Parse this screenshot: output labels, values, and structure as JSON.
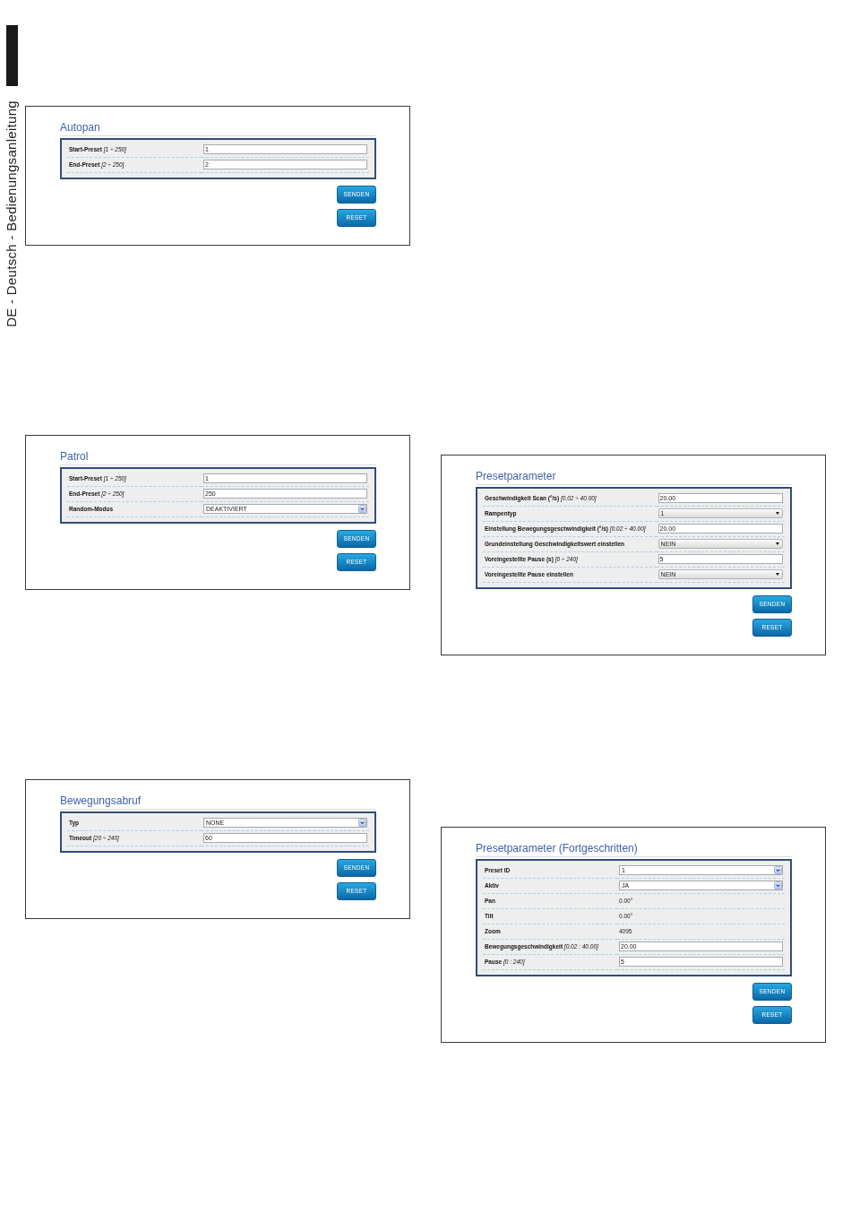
{
  "side_tab": {
    "label": "DE - Deutsch - Bedienungsanleitung"
  },
  "columns": [
    {
      "panels": [
        {
          "title": "Autopan",
          "fields": [
            {
              "kind": "input",
              "label": "Start-Preset",
              "range": "[1 ÷ 250]",
              "value": "1"
            },
            {
              "kind": "input",
              "label": "End-Preset",
              "range": "[2 ÷ 250]",
              "value": "2"
            }
          ],
          "buttons": [
            "SENDEN",
            "RESET"
          ]
        },
        {
          "title": "Patrol",
          "fields": [
            {
              "kind": "input",
              "label": "Start-Preset",
              "range": "[1 ÷ 250]",
              "value": "1"
            },
            {
              "kind": "input",
              "label": "End-Preset",
              "range": "[2 ÷ 250]",
              "value": "250"
            },
            {
              "kind": "select",
              "label": "Random-Modus",
              "value": "DEAKTIVIERT"
            }
          ],
          "buttons": [
            "SENDEN",
            "RESET"
          ]
        },
        {
          "title": "Bewegungsabruf",
          "fields": [
            {
              "kind": "select",
              "label": "Typ",
              "value": "NONE"
            },
            {
              "kind": "input",
              "label": "Timeout",
              "range": "[20 ÷ 240]",
              "value": "60"
            }
          ],
          "buttons": [
            "SENDEN",
            "RESET"
          ]
        }
      ]
    },
    {
      "panels": [
        {
          "title": "Presetparameter",
          "fields": [
            {
              "kind": "input",
              "label": "Geschwindigkeit Scan (°/s)",
              "range": "[0.02 ÷ 40.00]",
              "value": "20.00"
            },
            {
              "kind": "dropdown",
              "label": "Rampentyp",
              "value": "1"
            },
            {
              "kind": "input",
              "label": "Einstellung Bewegungsgeschwindigkeit (°/s)",
              "range": "[0.02 ÷ 40.00]",
              "value": "20.00"
            },
            {
              "kind": "dropdown",
              "label": "Grundeinstellung Geschwindigkeitswert einstellen",
              "value": "NEIN"
            },
            {
              "kind": "input",
              "label": "Voreingestellte Pause (s)",
              "range": "[0 ÷ 240]",
              "value": "5"
            },
            {
              "kind": "dropdown",
              "label": "Voreingestellte Pause einstellen",
              "value": "NEIN"
            }
          ],
          "buttons": [
            "SENDEN",
            "RESET"
          ]
        },
        {
          "title": "Presetparameter (Fortgeschritten)",
          "fields": [
            {
              "kind": "select",
              "label": "Preset ID",
              "value": "1"
            },
            {
              "kind": "select",
              "label": "Aktiv",
              "value": "JA"
            },
            {
              "kind": "text",
              "label": "Pan",
              "value": "0.00°"
            },
            {
              "kind": "text",
              "label": "Tilt",
              "value": "0.00°"
            },
            {
              "kind": "text",
              "label": "Zoom",
              "value": "4095"
            },
            {
              "kind": "input",
              "label": "Bewegungsgeschwindigkeit",
              "range": "[0.02 : 40.00]",
              "value": "20.00"
            },
            {
              "kind": "input",
              "label": "Pause",
              "range": "[0 : 240]",
              "value": "5"
            }
          ],
          "buttons": [
            "SENDEN",
            "RESET"
          ]
        }
      ]
    }
  ]
}
